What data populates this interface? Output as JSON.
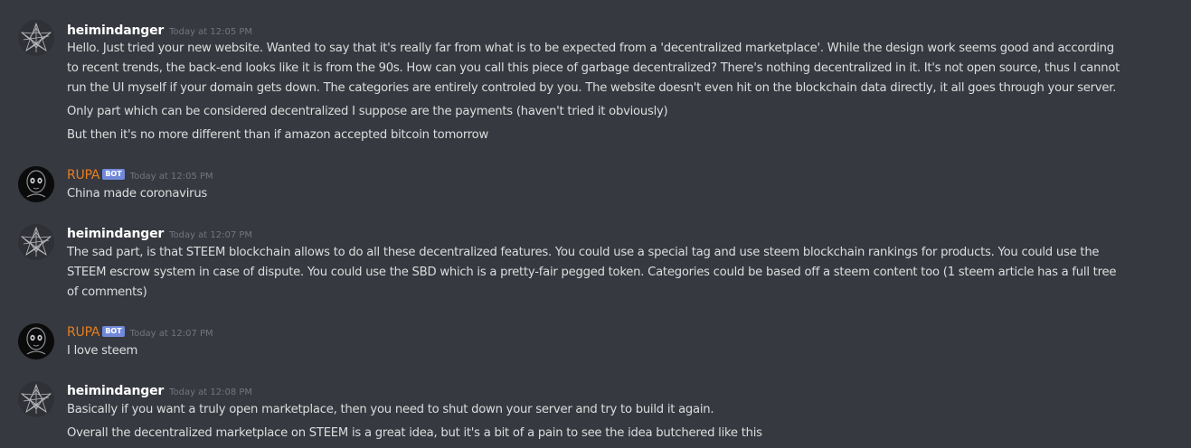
{
  "messages": [
    {
      "author": "heimindanger",
      "timestamp": "Today at 12:05 PM",
      "bot": false,
      "avatar_icon": "star-web-avatar-icon",
      "lines": [
        "Hello. Just tried your new website. Wanted to say that it's really far from what is to be expected from a 'decentralized marketplace'. While the design work seems good and according",
        "to recent trends, the back-end looks like it is from the 90s. How can you call this piece of garbage decentralized? There's nothing decentralized in it. It's not open source, thus I cannot",
        "run the UI myself if your domain gets down. The categories are entirely controled by you. The website doesn't even hit on the blockchain data directly, it all goes through your server.",
        "Only part which can be considered decentralized I suppose are the payments (haven't tried it obviously)",
        "But then it's no more different than if amazon accepted bitcoin tomorrow"
      ]
    },
    {
      "author": "RUPA",
      "bot_tag": "BOT",
      "timestamp": "Today at 12:05 PM",
      "bot": true,
      "avatar_icon": "alien-face-avatar-icon",
      "lines": [
        "China made coronavirus"
      ]
    },
    {
      "author": "heimindanger",
      "timestamp": "Today at 12:07 PM",
      "bot": false,
      "avatar_icon": "star-web-avatar-icon",
      "lines": [
        "The sad part, is that STEEM blockchain allows to do all these decentralized features. You could use a special tag and use steem blockchain rankings for products. You could use the",
        "STEEM escrow system in case of dispute. You could use the SBD which is a pretty-fair pegged token. Categories could be based off a steem content too (1 steem article has a full tree",
        "of comments)"
      ]
    },
    {
      "author": "RUPA",
      "bot_tag": "BOT",
      "timestamp": "Today at 12:07 PM",
      "bot": true,
      "avatar_icon": "alien-face-avatar-icon",
      "lines": [
        "I love steem"
      ]
    },
    {
      "author": "heimindanger",
      "timestamp": "Today at 12:08 PM",
      "bot": false,
      "avatar_icon": "star-web-avatar-icon",
      "lines": [
        "Basically if you want a truly open marketplace, then you need to shut down your server and try to build it again.",
        "Overall the decentralized marketplace on STEEM is a great idea, but it's a bit of a pain to see the idea butchered like this"
      ]
    }
  ],
  "colors": {
    "background": "#36393f",
    "username": "#ffffff",
    "bot_username": "#e67e22",
    "bot_tag": "#7289da",
    "timestamp": "#72767d",
    "message_text": "#dcddde"
  }
}
